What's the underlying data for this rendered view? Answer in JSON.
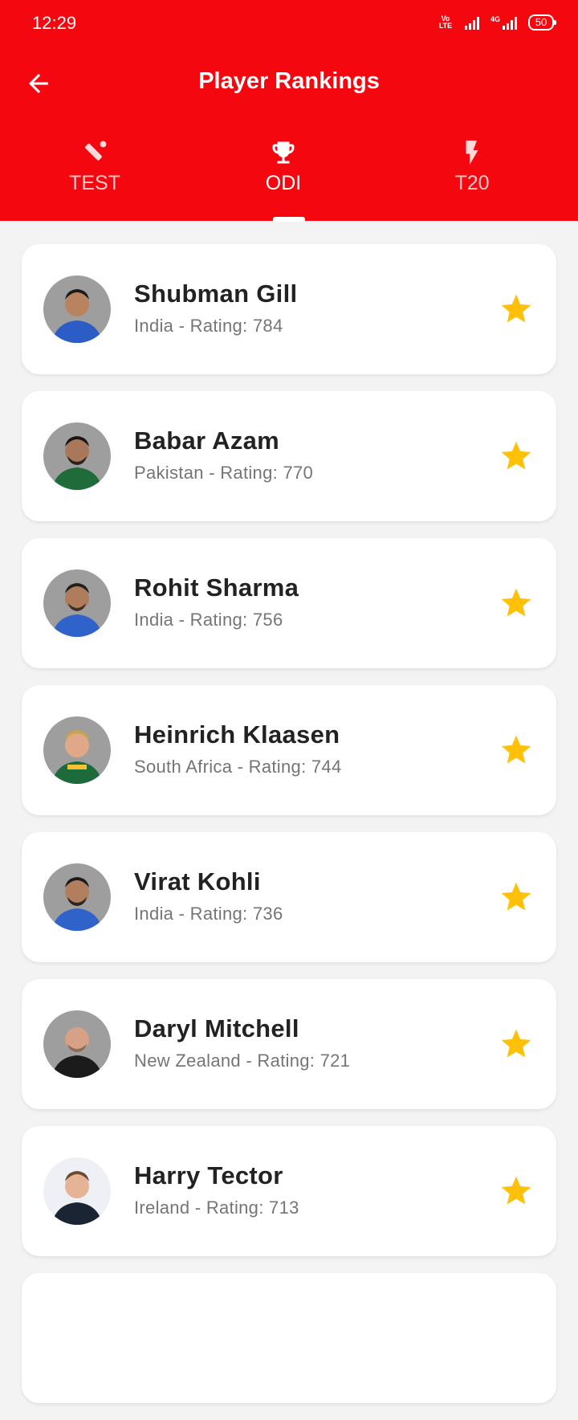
{
  "status_bar": {
    "time": "12:29",
    "volte_label": "VoB LTE2",
    "network_label": "4G",
    "battery": "50"
  },
  "header": {
    "title": "Player Rankings",
    "back_icon": "arrow-left-icon"
  },
  "tabs": [
    {
      "label": "TEST",
      "icon": "cricket-bat-icon",
      "active": false
    },
    {
      "label": "ODI",
      "icon": "trophy-icon",
      "active": true
    },
    {
      "label": "T20",
      "icon": "lightning-icon",
      "active": false
    }
  ],
  "players": [
    {
      "name": "Shubman Gill",
      "meta": "India - Rating: 784",
      "country": "India",
      "rating": 784,
      "favorite": true
    },
    {
      "name": "Babar Azam",
      "meta": "Pakistan - Rating: 770",
      "country": "Pakistan",
      "rating": 770,
      "favorite": true
    },
    {
      "name": "Rohit Sharma",
      "meta": "India - Rating: 756",
      "country": "India",
      "rating": 756,
      "favorite": true
    },
    {
      "name": "Heinrich Klaasen",
      "meta": "South Africa - Rating: 744",
      "country": "South Africa",
      "rating": 744,
      "favorite": true
    },
    {
      "name": "Virat Kohli",
      "meta": "India - Rating: 736",
      "country": "India",
      "rating": 736,
      "favorite": true
    },
    {
      "name": "Daryl Mitchell",
      "meta": "New Zealand - Rating: 721",
      "country": "New Zealand",
      "rating": 721,
      "favorite": true
    },
    {
      "name": "Harry Tector",
      "meta": "Ireland - Rating: 713",
      "country": "Ireland",
      "rating": 713,
      "favorite": true
    }
  ],
  "colors": {
    "primary": "#f5070f",
    "star": "#ffc107",
    "background": "#f3f3f3",
    "name_text": "#222222",
    "meta_text": "#757575"
  }
}
